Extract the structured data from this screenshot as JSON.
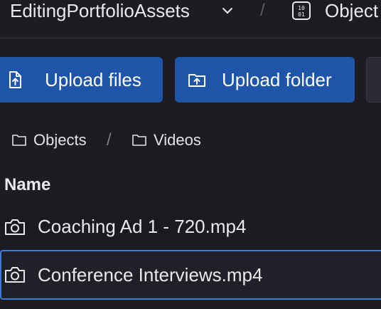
{
  "header": {
    "bucket_name": "EditingPortfolioAssets",
    "separator": "/",
    "current_section": "Object"
  },
  "actions": {
    "upload_files_label": "Upload files",
    "upload_folder_label": "Upload folder"
  },
  "path": {
    "root_label": "Objects",
    "separator": "/",
    "folder_label": "Videos"
  },
  "table": {
    "column_name": "Name",
    "rows": [
      {
        "name": "Coaching Ad 1 - 720.mp4",
        "icon": "camera-icon",
        "selected": false
      },
      {
        "name": "Conference Interviews.mp4",
        "icon": "camera-icon",
        "selected": true
      }
    ]
  },
  "colors": {
    "background": "#1c1c22",
    "primary_button": "#1f55a8",
    "selection_border": "#3e7ad6",
    "text": "#e8e9ee"
  }
}
